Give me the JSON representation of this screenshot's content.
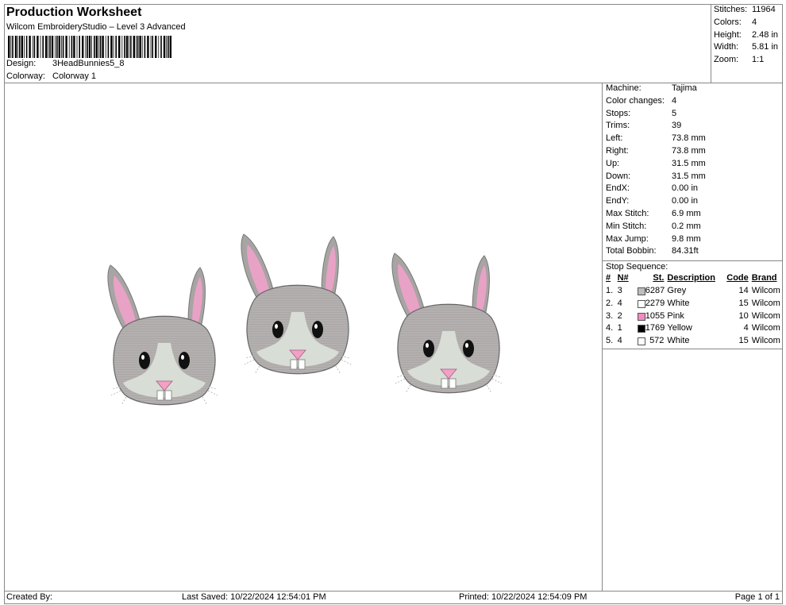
{
  "header": {
    "title": "Production Worksheet",
    "subtitle": "Wilcom EmbroideryStudio – Level 3 Advanced",
    "design_label": "Design:",
    "design": "3HeadBunnies5_8",
    "colorway_label": "Colorway:",
    "colorway": "Colorway 1"
  },
  "summary": [
    {
      "k": "Stitches:",
      "v": "11964"
    },
    {
      "k": "Colors:",
      "v": "4"
    },
    {
      "k": "Height:",
      "v": "2.48 in"
    },
    {
      "k": "Width:",
      "v": "5.81 in"
    },
    {
      "k": "Zoom:",
      "v": "1:1"
    }
  ],
  "stats": [
    {
      "k": "Machine:",
      "v": "Tajima"
    },
    {
      "k": "Color changes:",
      "v": "4"
    },
    {
      "k": "Stops:",
      "v": "5"
    },
    {
      "k": "Trims:",
      "v": "39"
    },
    {
      "k": "Left:",
      "v": "73.8 mm"
    },
    {
      "k": "Right:",
      "v": "73.8 mm"
    },
    {
      "k": "Up:",
      "v": "31.5 mm"
    },
    {
      "k": "Down:",
      "v": "31.5 mm"
    },
    {
      "k": "EndX:",
      "v": "0.00 in"
    },
    {
      "k": "EndY:",
      "v": "0.00 in"
    },
    {
      "k": "Max Stitch:",
      "v": "6.9 mm"
    },
    {
      "k": "Min Stitch:",
      "v": "0.2 mm"
    },
    {
      "k": "Max Jump:",
      "v": "9.8 mm"
    },
    {
      "k": "Total Bobbin:",
      "v": "84.31ft"
    }
  ],
  "stop_sequence": {
    "title": "Stop Sequence:",
    "headers": [
      "#",
      "N#",
      "St.",
      "Description",
      "Code",
      "Brand"
    ],
    "rows": [
      {
        "n": "1.",
        "nn": "3",
        "color": "#bdbdbd",
        "st": "6287",
        "desc": "Grey",
        "code": "14",
        "brand": "Wilcom"
      },
      {
        "n": "2.",
        "nn": "4",
        "color": "#ffffff",
        "st": "2279",
        "desc": "White",
        "code": "15",
        "brand": "Wilcom"
      },
      {
        "n": "3.",
        "nn": "2",
        "color": "#f08cc0",
        "st": "1055",
        "desc": "Pink",
        "code": "10",
        "brand": "Wilcom"
      },
      {
        "n": "4.",
        "nn": "1",
        "color": "#000000",
        "st": "1769",
        "desc": "Yellow",
        "code": "4",
        "brand": "Wilcom"
      },
      {
        "n": "5.",
        "nn": "4",
        "color": "#ffffff",
        "st": "572",
        "desc": "White",
        "code": "15",
        "brand": "Wilcom"
      }
    ]
  },
  "footer": {
    "created": "Created By:",
    "saved": "Last Saved: 10/22/2024 12:54:01 PM",
    "printed": "Printed: 10/22/2024 12:54:09 PM",
    "page": "Page 1 of 1"
  }
}
